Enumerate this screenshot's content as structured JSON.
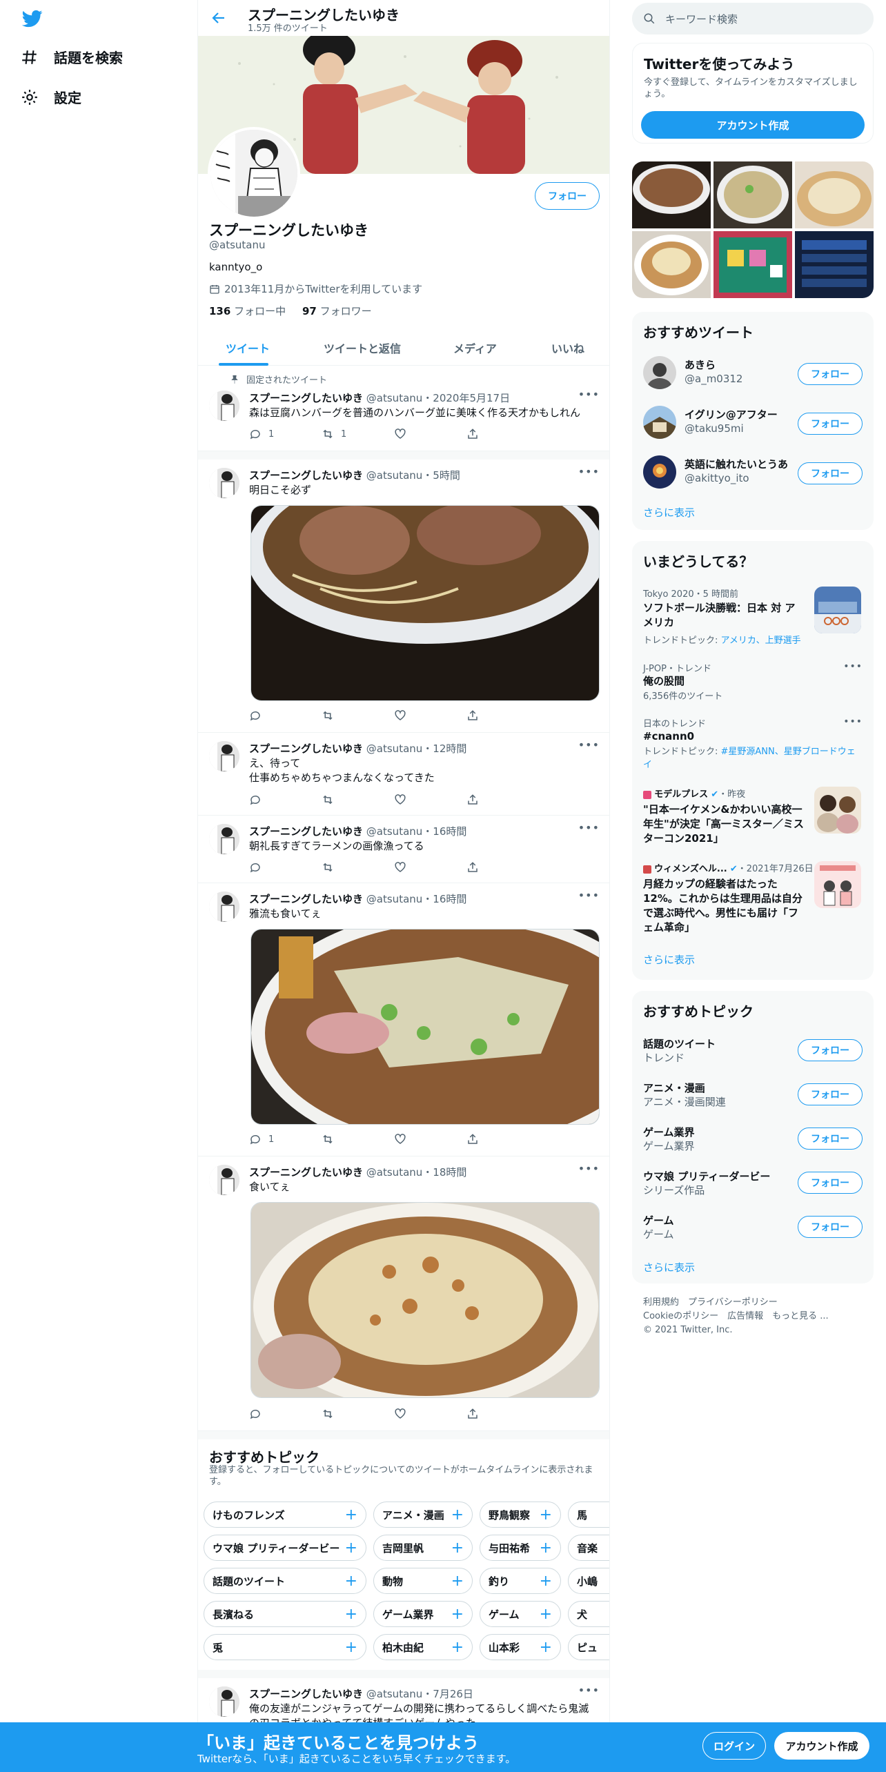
{
  "nav": {
    "explore_label": "話題を検索",
    "settings_label": "設定"
  },
  "header": {
    "name": "スプーニングしたいゆき",
    "tweet_count": "1.5万 件のツイート"
  },
  "profile": {
    "name": "スプーニングしたいゆき",
    "handle": "@atsutanu",
    "bio": "kanntyo_o",
    "joined": "2013年11月からTwitterを利用しています",
    "following_count": "136",
    "following_label": "フォロー中",
    "followers_count": "97",
    "followers_label": "フォロワー",
    "follow_label": "フォロー"
  },
  "tabs": [
    "ツイート",
    "ツイートと返信",
    "メディア",
    "いいね"
  ],
  "pinned_label": "固定されたツイート",
  "tweets": [
    {
      "name": "スプーニングしたいゆき",
      "meta": "@atsutanu・2020年5月17日",
      "text": "森は豆腐ハンバーグを普通のハンバーグ並に美味く作る天才かもしれん",
      "reply": "1",
      "retweet": "1",
      "like": ""
    },
    {
      "name": "スプーニングしたいゆき",
      "meta": "@atsutanu・5時間",
      "text": "明日こそ必ず"
    },
    {
      "name": "スプーニングしたいゆき",
      "meta": "@atsutanu・12時間",
      "text": "え、待って",
      "text2": "仕事めちゃめちゃつまんなくなってきた"
    },
    {
      "name": "スプーニングしたいゆき",
      "meta": "@atsutanu・16時間",
      "text": "朝礼長すぎてラーメンの画像漁ってる"
    },
    {
      "name": "スプーニングしたいゆき",
      "meta": "@atsutanu・16時間",
      "text": "雅流も食いてぇ",
      "reply": "1"
    },
    {
      "name": "スプーニングしたいゆき",
      "meta": "@atsutanu・18時間",
      "text": "食いてぇ"
    },
    {
      "name": "スプーニングしたいゆき",
      "meta": "@atsutanu・7月26日",
      "text": "俺の友達がニンジャラってゲームの開発に携わってるらしく調べたら鬼滅",
      "text2": "の刃コラボとかやってて結構すごいゲームやった"
    }
  ],
  "topics_section": {
    "title": "おすすめトピック",
    "desc": "登録すると、フォローしているトピックについてのツイートがホームタイムラインに表示されます。",
    "rows": [
      [
        "けものフレンズ",
        "アニメ・漫画",
        "野鳥観察",
        "馬"
      ],
      [
        "ウマ娘 プリティーダービー",
        "吉岡里帆",
        "与田祐希",
        "音楽"
      ],
      [
        "話題のツイート",
        "動物",
        "釣り",
        "小嶋"
      ],
      [
        "長濱ねる",
        "ゲーム業界",
        "ゲーム",
        "犬"
      ],
      [
        "兎",
        "柏木由紀",
        "山本彩",
        "ピュ"
      ]
    ]
  },
  "right": {
    "search_placeholder": "キーワード検索",
    "signup_card": {
      "title": "Twitterを使ってみよう",
      "desc": "今すぐ登録して、タイムラインをカスタマイズしましょう。",
      "button": "アカウント作成"
    },
    "recommend": {
      "title": "おすすめツイート",
      "users": [
        {
          "name": "あきら",
          "handle": "@a_m0312"
        },
        {
          "name": "イグリン@アフター",
          "handle": "@taku95mi"
        },
        {
          "name": "英語に触れたいとうあ",
          "handle": "@akittyo_ito"
        }
      ],
      "follow_label": "フォロー",
      "more": "さらに表示"
    },
    "trends": {
      "title": "いまどうしてる？",
      "items": [
        {
          "meta": "Tokyo 2020・5 時間前",
          "title": "ソフトボール決勝戦：日本 対 アメリカ",
          "sub_prefix": "トレンドトピック: ",
          "sub_links": "アメリカ、上野選手"
        },
        {
          "meta": "J-POP・トレンド",
          "title": "俺の股間",
          "sub": "6,356件のツイート"
        },
        {
          "meta": "日本のトレンド",
          "title": "#cnann0",
          "sub_prefix": "トレンドトピック: ",
          "sub_links": "#星野源ANN、星野ブロードウェイ"
        },
        {
          "meta_source": "モデルプレス",
          "meta_time": "・昨夜",
          "title": "\"日本一イケメン&かわいい高校一年生\"が決定「高一ミスター／ミスターコン2021」"
        },
        {
          "meta_source": "ウィメンズヘル...",
          "meta_time": "・2021年7月26日",
          "title": "月経カップの経験者はたった12%。これからは生理用品は自分で選ぶ時代へ。男性にも届け「フェム革命」"
        }
      ],
      "more": "さらに表示"
    },
    "topics": {
      "title": "おすすめトピック",
      "items": [
        {
          "name": "話題のツイート",
          "sub": "トレンド"
        },
        {
          "name": "アニメ・漫画",
          "sub": "アニメ・漫画関連"
        },
        {
          "name": "ゲーム業界",
          "sub": "ゲーム業界"
        },
        {
          "name": "ウマ娘 プリティーダービー",
          "sub": "シリーズ作品"
        },
        {
          "name": "ゲーム",
          "sub": "ゲーム"
        }
      ],
      "follow_label": "フォロー",
      "more": "さらに表示"
    },
    "footer": {
      "line1": "利用規約　プライバシーポリシー",
      "line2": "Cookieのポリシー　広告情報　もっと見る ...",
      "line3": "© 2021 Twitter, Inc."
    }
  },
  "bottom": {
    "title": "「いま」起きていることを見つけよう",
    "sub": "Twitterなら、「いま」起きていることをいち早くチェックできます。",
    "login": "ログイン",
    "signup": "アカウント作成"
  },
  "colors": {
    "accent": "#1d9bf0",
    "bottom_bar": "#1d9bf0"
  }
}
